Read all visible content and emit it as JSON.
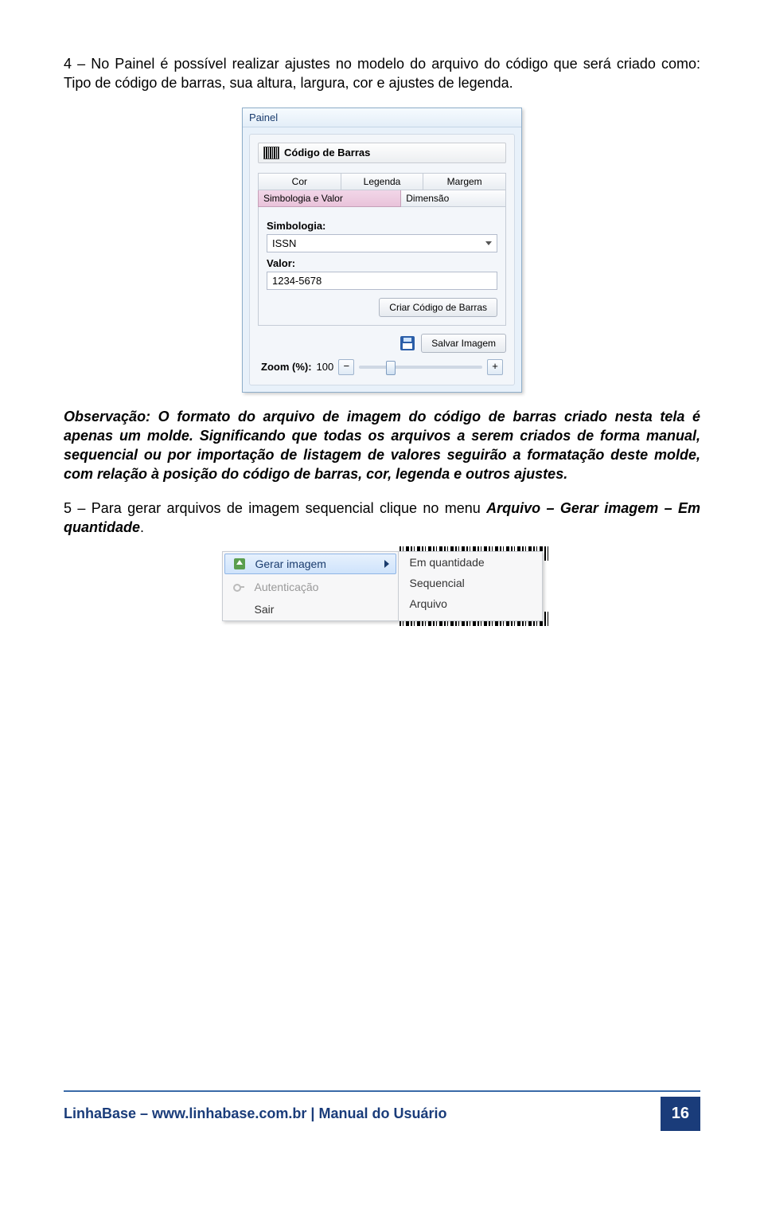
{
  "para1": "4 – No Painel é possível realizar ajustes no modelo do arquivo do código que será criado como: Tipo de código de barras, sua altura, largura, cor e ajustes de legenda.",
  "painel": {
    "title": "Painel",
    "section": "Código de Barras",
    "tabs": {
      "cor": "Cor",
      "legenda": "Legenda",
      "margem": "Margem",
      "simbologia_valor": "Simbologia e Valor",
      "dimensao": "Dimensão"
    },
    "form": {
      "simbologia_label": "Simbologia:",
      "simbologia_value": "ISSN",
      "valor_label": "Valor:",
      "valor_value": "1234-5678",
      "criar_btn": "Criar Código de Barras",
      "salvar_btn": "Salvar Imagem"
    },
    "zoom": {
      "label": "Zoom (%):",
      "value": "100"
    }
  },
  "para2": "Observação: O formato do arquivo de imagem do código de barras criado nesta tela é apenas um molde. Significando que todas os arquivos a serem criados de forma manual, sequencial ou por importação de listagem de valores seguirão a formatação deste molde, com relação à posição do código de barras, cor, legenda e outros ajustes.",
  "para3_a": "5 – Para gerar arquivos de imagem sequencial clique no menu ",
  "para3_b": "Arquivo – Gerar imagem – Em quantidade",
  "para3_c": ".",
  "menu": {
    "gerar": "Gerar imagem",
    "autenticacao": "Autenticação",
    "sair": "Sair",
    "sub1": "Em quantidade",
    "sub2": "Sequencial",
    "sub3": "Arquivo"
  },
  "footer": {
    "text": "LinhaBase – www.linhabase.com.br | Manual do Usuário",
    "page": "16"
  }
}
